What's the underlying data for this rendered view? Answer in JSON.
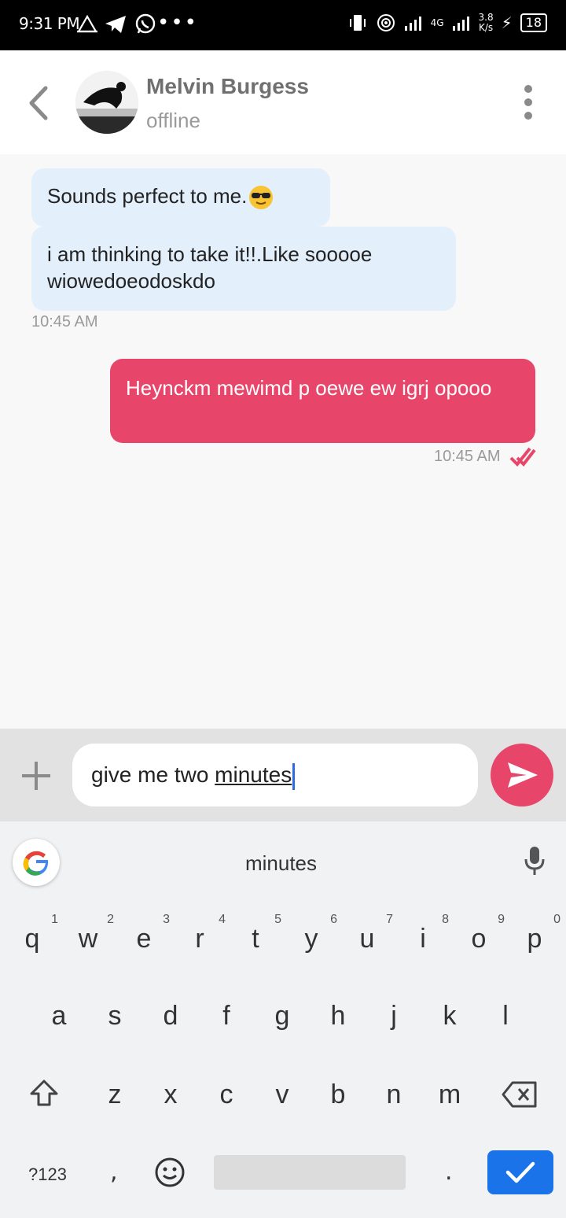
{
  "status_bar": {
    "time": "9:31 PM",
    "network_speed": "3.8",
    "network_speed_unit": "K/s",
    "network_type": "4G",
    "battery": "18"
  },
  "header": {
    "contact_name": "Melvin Burgess",
    "contact_status": "offline"
  },
  "messages": [
    {
      "direction": "incoming",
      "text": "Sounds perfect to me."
    },
    {
      "direction": "incoming",
      "text": "i am thinking to take it!!.Like sooooe wiowedoeodoskdo",
      "time": "10:45 AM"
    },
    {
      "direction": "outgoing",
      "text": "Heynckm mewimd p oewe ew igrj opooo",
      "time": "10:45 AM"
    }
  ],
  "composer": {
    "text_before": "give me two ",
    "text_underlined": "minutes"
  },
  "keyboard": {
    "suggestion": "minutes",
    "row1": [
      "q",
      "w",
      "e",
      "r",
      "t",
      "y",
      "u",
      "i",
      "o",
      "p"
    ],
    "row1_hints": [
      "1",
      "2",
      "3",
      "4",
      "5",
      "6",
      "7",
      "8",
      "9",
      "0"
    ],
    "row2": [
      "a",
      "s",
      "d",
      "f",
      "g",
      "h",
      "j",
      "k",
      "l"
    ],
    "row3": [
      "z",
      "x",
      "c",
      "v",
      "b",
      "n",
      "m"
    ],
    "symbols_key": "?123",
    "comma": ",",
    "period": "."
  },
  "colors": {
    "accent": "#e8456a",
    "incoming_bubble": "#e3f0fc",
    "enter_key": "#1a73e8"
  },
  "icons": [
    "back-arrow-icon",
    "more-vert-icon",
    "plus-icon",
    "send-icon",
    "google-icon",
    "mic-icon",
    "shift-icon",
    "backspace-icon",
    "emoji-icon",
    "check-icon",
    "double-check-icon"
  ]
}
